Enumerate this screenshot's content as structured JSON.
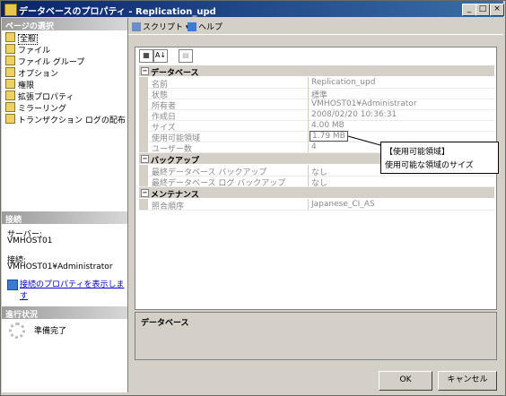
{
  "window": {
    "title": "データベースのプロパティ - Replication_upd",
    "min": "_",
    "max": "□",
    "close": "×"
  },
  "left": {
    "select_page_header": "ページの選択",
    "pages": [
      "全般",
      "ファイル",
      "ファイル グループ",
      "オプション",
      "権限",
      "拡張プロパティ",
      "ミラーリング",
      "トランザクション ログの配布"
    ],
    "connection_header": "接続",
    "server_label": "サーバー:",
    "server_value": "VMHOST01",
    "connection_label": "接続:",
    "connection_value": "VMHOST01¥Administrator",
    "view_props_link": "接続のプロパティを表示します",
    "progress_header": "進行状況",
    "progress_status": "準備完了"
  },
  "toolbar": {
    "script": "スクリプト",
    "help": "ヘルプ"
  },
  "grid": {
    "categories": [
      {
        "label": "データベース",
        "rows": [
          {
            "name": "名前",
            "value": "Replication_upd"
          },
          {
            "name": "状態",
            "value": "標準"
          },
          {
            "name": "所有者",
            "value": "VMHOST01¥Administrator"
          },
          {
            "name": "作成日",
            "value": "2008/02/20 10:36:31"
          },
          {
            "name": "サイズ",
            "value": "4.00 MB"
          },
          {
            "name": "使用可能領域",
            "value": "1.79 MB"
          },
          {
            "name": "ユーザー数",
            "value": "4"
          }
        ]
      },
      {
        "label": "バックアップ",
        "rows": [
          {
            "name": "最終データベース バックアップ",
            "value": "なし"
          },
          {
            "name": "最終データベース ログ バックアップ",
            "value": "なし"
          }
        ]
      },
      {
        "label": "メンテナンス",
        "rows": [
          {
            "name": "照合順序",
            "value": "Japanese_CI_AS"
          }
        ]
      }
    ],
    "toggle": "−"
  },
  "description": {
    "title": "データベース"
  },
  "callout": {
    "line1": "【使用可能領域】",
    "line2": "使用可能な領域のサイズ"
  },
  "buttons": {
    "ok": "OK",
    "cancel": "キャンセル"
  }
}
